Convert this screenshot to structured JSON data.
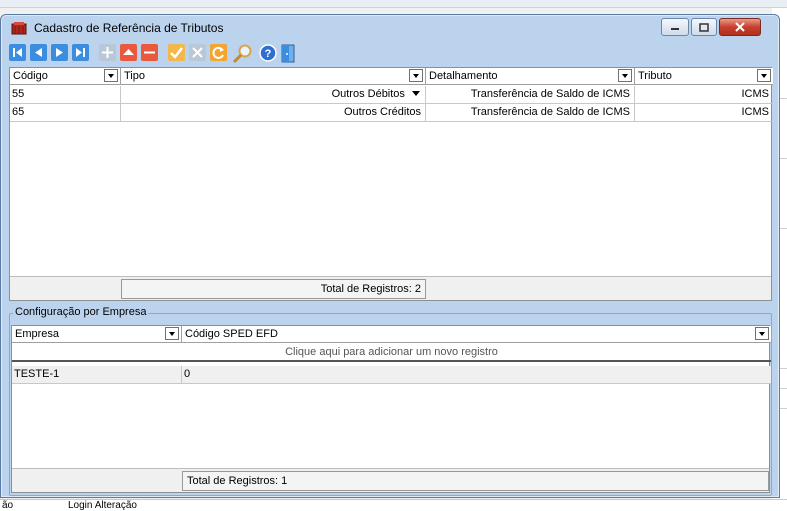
{
  "window": {
    "title": "Cadastro de Referência de Tributos"
  },
  "toolbar": {
    "buttons": [
      {
        "icon": "first-record-icon",
        "color": "#3b8de0"
      },
      {
        "icon": "previous-record-icon",
        "color": "#3b8de0"
      },
      {
        "icon": "next-record-icon",
        "color": "#3b8de0"
      },
      {
        "icon": "last-record-icon",
        "color": "#3b8de0"
      },
      {
        "icon": "add-record-icon",
        "color": "#b9c7d6"
      },
      {
        "icon": "edit-up-icon",
        "color": "#e8593e"
      },
      {
        "icon": "delete-record-icon",
        "color": "#e8593e"
      },
      {
        "icon": "confirm-check-icon",
        "color": "#f2b84b"
      },
      {
        "icon": "cancel-x-icon",
        "color": "#b9c7d6"
      },
      {
        "icon": "refresh-icon",
        "color": "#f2a62f"
      },
      {
        "icon": "search-icon",
        "color": "#d9a44a"
      },
      {
        "icon": "help-icon",
        "color": "#2f6fcf"
      },
      {
        "icon": "exit-door-icon",
        "color": "#3b8de0"
      }
    ]
  },
  "tributos_grid": {
    "columns": [
      "Código",
      "Tipo",
      "Detalhamento",
      "Tributo"
    ],
    "rows": [
      {
        "codigo": "55",
        "tipo": "Outros Débitos",
        "detalhamento": "Transferência de Saldo de ICMS",
        "tributo": "ICMS"
      },
      {
        "codigo": "65",
        "tipo": "Outros Créditos",
        "detalhamento": "Transferência de Saldo de ICMS",
        "tributo": "ICMS"
      }
    ],
    "total_label": "Total de Registros: 2"
  },
  "empresa_group": {
    "label": "Configuração por Empresa",
    "columns": [
      "Empresa",
      "Código SPED EFD"
    ],
    "add_hint": "Clique aqui para adicionar um novo registro",
    "rows": [
      {
        "empresa": "TESTE-1",
        "codigo_sped": "0"
      }
    ],
    "total_label": "Total de Registros: 1"
  },
  "background": {
    "bottom_left_text": "ão",
    "bottom_login_text": "Login Alteração"
  }
}
